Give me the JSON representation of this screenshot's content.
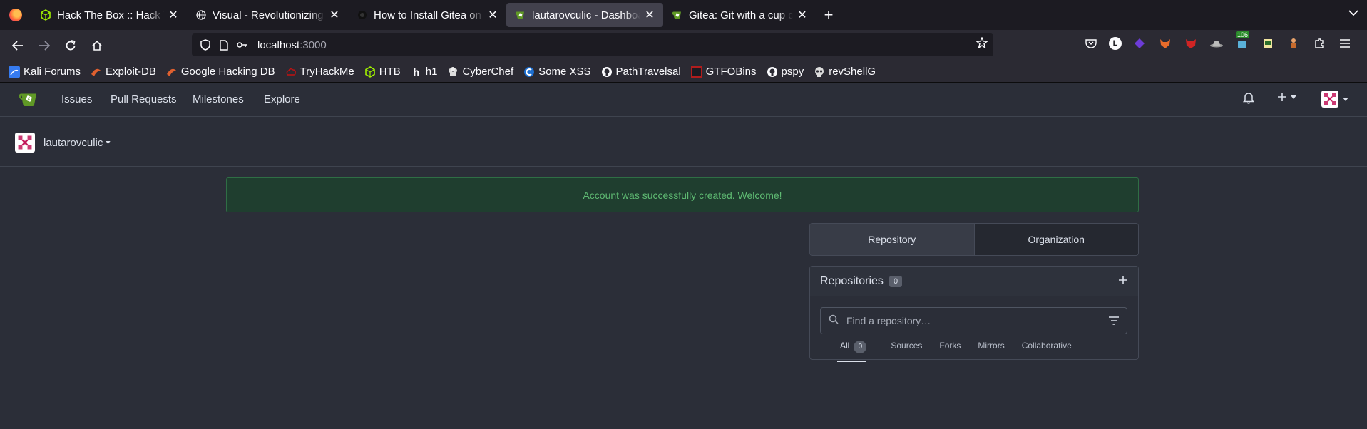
{
  "browser": {
    "tabs": [
      {
        "title": "Hack The Box :: Hack The Box",
        "icon": "htb-icon",
        "active": false
      },
      {
        "title": "Visual - Revolutionizing Visual Studio",
        "icon": "globe-icon",
        "active": false
      },
      {
        "title": "How to Install Gitea on Ubuntu",
        "icon": "site-icon",
        "active": false
      },
      {
        "title": "lautarovculic - Dashboard",
        "icon": "gitea-icon",
        "active": true
      },
      {
        "title": "Gitea: Git with a cup of tea",
        "icon": "gitea-icon",
        "active": false
      }
    ],
    "url_host": "localhost",
    "url_port": ":3000",
    "extension_badge": "106",
    "ext_letter": "L",
    "bookmarks": [
      {
        "label": "Kali Forums",
        "icon": "kali-icon",
        "color": "#367bf0"
      },
      {
        "label": "Exploit-DB",
        "icon": "exploitdb-icon",
        "color": "#e0602f"
      },
      {
        "label": "Google Hacking DB",
        "icon": "ghdb-icon",
        "color": "#e0602f"
      },
      {
        "label": "TryHackMe",
        "icon": "tryhackme-icon",
        "color": "#c11111"
      },
      {
        "label": "HTB",
        "icon": "htb-icon",
        "color": "#9fef00"
      },
      {
        "label": "h1",
        "icon": "hackerone-icon",
        "color": "#ffffff"
      },
      {
        "label": "CyberChef",
        "icon": "cyberchef-icon",
        "color": "#cccccc"
      },
      {
        "label": "Some XSS",
        "icon": "xss-icon",
        "color": "#1d6fd1"
      },
      {
        "label": "PathTravelsal",
        "icon": "github-icon",
        "color": "#ffffff"
      },
      {
        "label": "GTFOBins",
        "icon": "gtfobins-icon",
        "color": "#b11d1d"
      },
      {
        "label": "pspy",
        "icon": "github-icon",
        "color": "#ffffff"
      },
      {
        "label": "revShellG",
        "icon": "skull-icon",
        "color": "#dddddd"
      }
    ]
  },
  "gitea": {
    "nav": [
      "Issues",
      "Pull Requests",
      "Milestones",
      "Explore"
    ],
    "context_user": "lautarovculic",
    "flash_message": "Account was successfully created. Welcome!",
    "switch": {
      "repository": "Repository",
      "organization": "Organization"
    },
    "repos": {
      "title": "Repositories",
      "count": "0",
      "search_placeholder": "Find a repository…",
      "filters": [
        {
          "label": "All",
          "count": "0",
          "active": true
        },
        {
          "label": "Sources"
        },
        {
          "label": "Forks"
        },
        {
          "label": "Mirrors"
        },
        {
          "label": "Collaborative"
        }
      ]
    }
  },
  "colors": {
    "page_bg": "#2b2e38",
    "flash_bg": "#1f3e2f",
    "flash_text": "#5fbb73",
    "gitea_green": "#609926"
  }
}
